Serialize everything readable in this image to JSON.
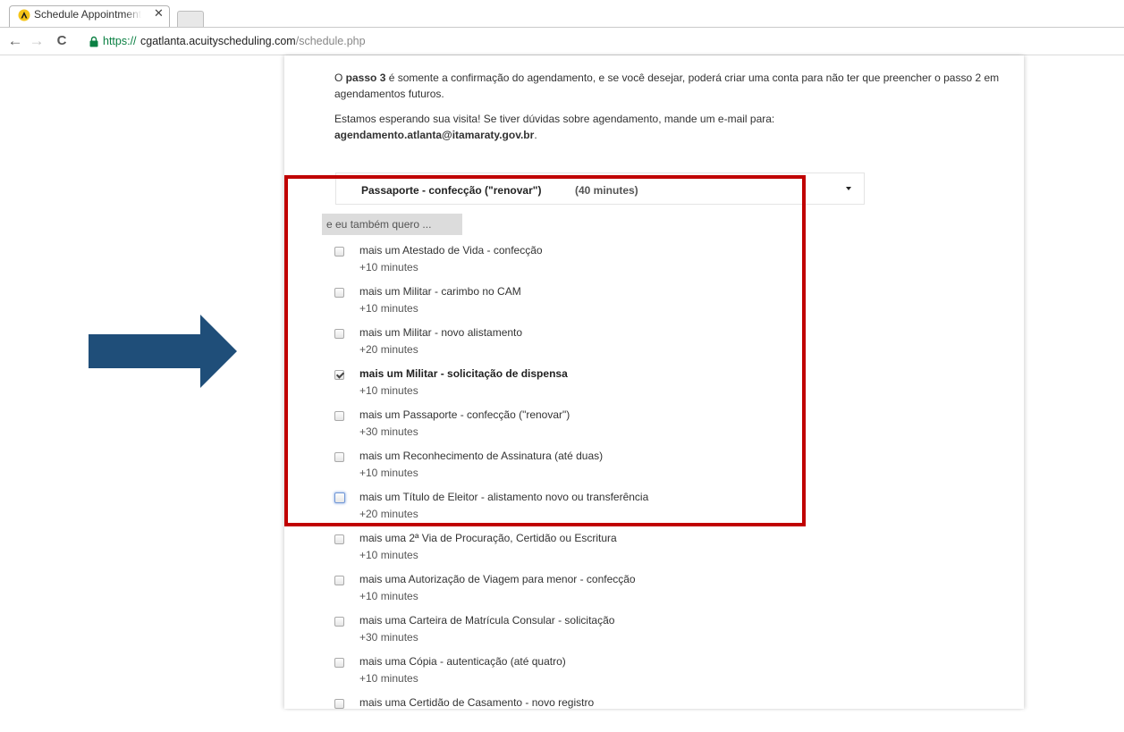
{
  "browser": {
    "tab_title": "Schedule Appointment with",
    "tab_close": "✕",
    "url_secure": "https://",
    "url_host": "cgatlanta.acuityscheduling.com",
    "url_path": "/schedule.php",
    "back": "←",
    "forward": "→",
    "reload": "C"
  },
  "intro": {
    "p1_before": "O ",
    "p1_bold": "passo 3",
    "p1_after": " é somente a confirmação do agendamento, e se você desejar, poderá criar uma conta para não ter que preencher o passo 2 em agendamentos futuros.",
    "p2_text": "Estamos esperando sua visita! Se tiver dúvidas sobre agendamento, mande um e-mail para:",
    "p2_email": "agendamento.atlanta@itamaraty.gov.br",
    "p2_period": "."
  },
  "service": {
    "name": "Passaporte - confecção (\"renovar\")",
    "duration": "(40 minutes)"
  },
  "addons": {
    "header": "e eu também quero ...",
    "items": [
      {
        "label": "mais um Atestado de Vida - confecção",
        "time": "+10 minutes",
        "checked": false
      },
      {
        "label": "mais um Militar - carimbo no CAM",
        "time": "+10 minutes",
        "checked": false
      },
      {
        "label": "mais um Militar - novo alistamento",
        "time": "+20 minutes",
        "checked": false
      },
      {
        "label": "mais um Militar - solicitação de dispensa",
        "time": "+10 minutes",
        "checked": true
      },
      {
        "label": "mais um Passaporte - confecção (\"renovar\")",
        "time": "+30 minutes",
        "checked": false
      },
      {
        "label": "mais um Reconhecimento de Assinatura (até duas)",
        "time": "+10 minutes",
        "checked": false
      },
      {
        "label": "mais um Título de Eleitor - alistamento novo ou transferência",
        "time": "+20 minutes",
        "checked": false,
        "focused": true
      },
      {
        "label": "mais uma 2ª Via de Procuração, Certidão ou Escritura",
        "time": "+10 minutes",
        "checked": false
      },
      {
        "label": "mais uma Autorização de Viagem para menor - confecção",
        "time": "+10 minutes",
        "checked": false
      },
      {
        "label": "mais uma Carteira de Matrícula Consular - solicitação",
        "time": "+30 minutes",
        "checked": false
      },
      {
        "label": "mais uma Cópia - autenticação (até quatro)",
        "time": "+10 minutes",
        "checked": false
      },
      {
        "label": "mais uma Certidão de Casamento - novo registro",
        "time": "",
        "checked": false
      }
    ]
  },
  "colors": {
    "highlight": "#c00000",
    "arrow": "#1f4e79"
  }
}
